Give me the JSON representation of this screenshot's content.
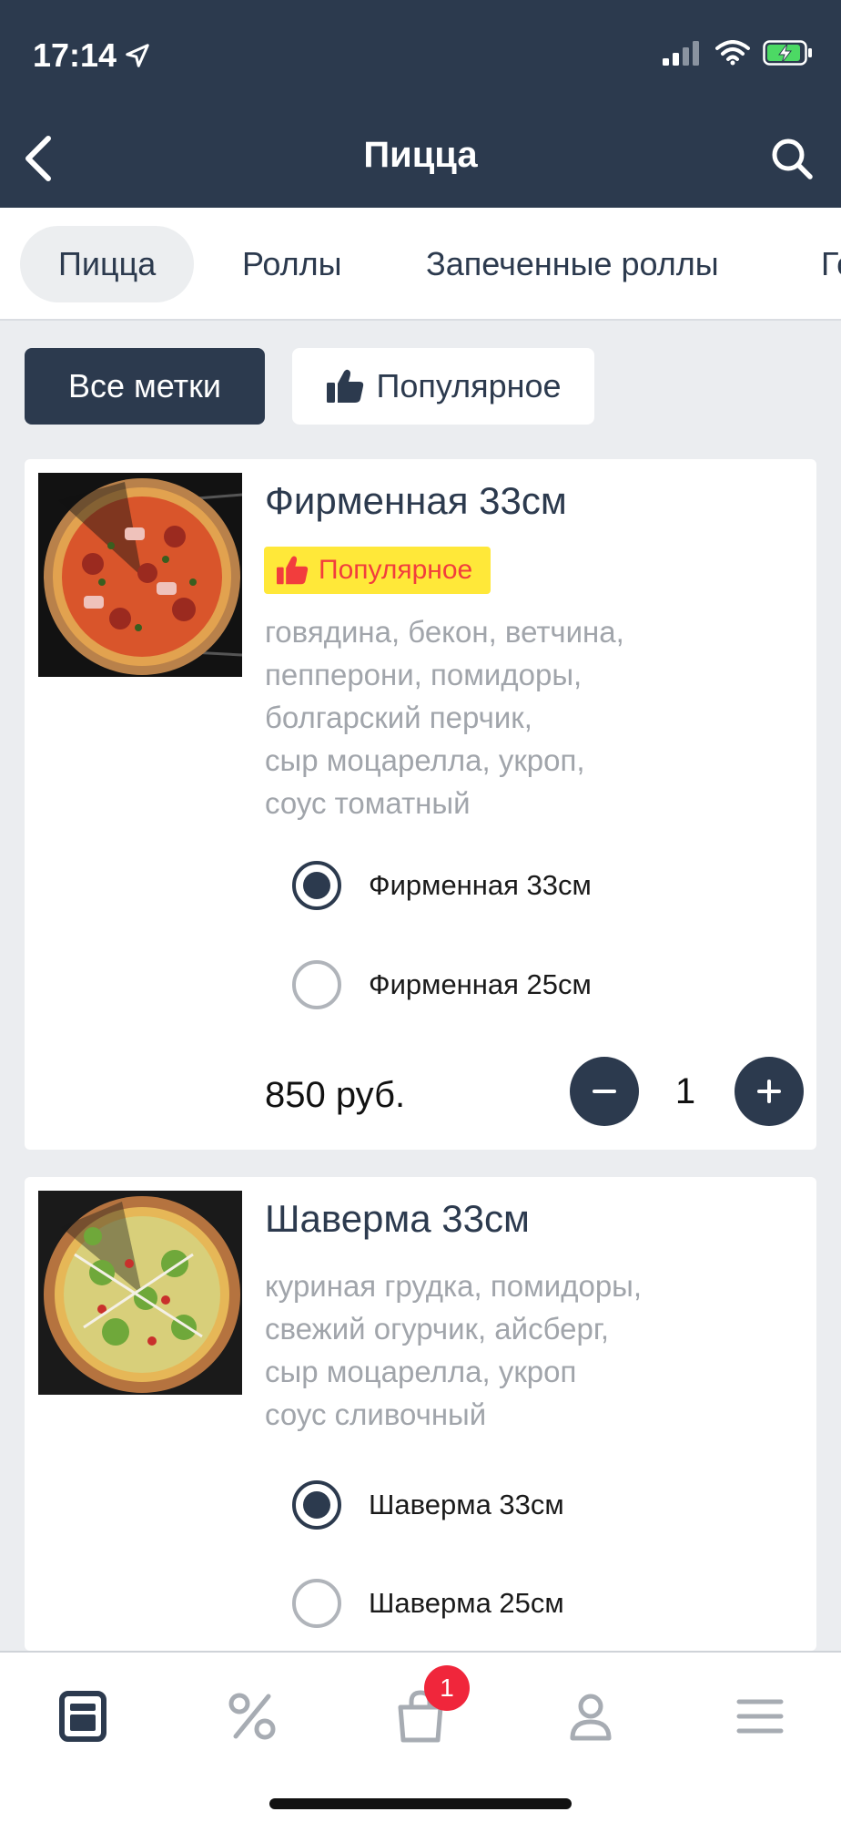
{
  "status_bar": {
    "time": "17:14"
  },
  "header": {
    "title": "Пицца"
  },
  "categories": [
    {
      "label": "Пицца",
      "active": true
    },
    {
      "label": "Роллы"
    },
    {
      "label": "Запеченные роллы"
    },
    {
      "label": "Го"
    }
  ],
  "filters": {
    "all_label": "Все метки",
    "popular_label": "Популярное"
  },
  "products": [
    {
      "title": "Фирменная 33см",
      "badge": "Популярное",
      "description": "говядина, бекон, ветчина,\nпепперони, помидоры,\nболгарский перчик,\nсыр моцарелла, укроп,\nсоус томатный",
      "variants": [
        {
          "label": "Фирменная 33см",
          "selected": true
        },
        {
          "label": "Фирменная 25см",
          "selected": false
        }
      ],
      "price": "850 руб.",
      "quantity": "1"
    },
    {
      "title": "Шаверма 33см",
      "description": "куриная грудка, помидоры,\nсвежий огурчик, айсберг,\nсыр моцарелла, укроп\nсоус сливочный",
      "variants": [
        {
          "label": "Шаверма 33см",
          "selected": true
        },
        {
          "label": "Шаверма 25см",
          "selected": false
        }
      ]
    }
  ],
  "tabbar": {
    "cart_count": "1"
  },
  "colors": {
    "primary": "#2c3a4e",
    "badge_bg": "#ffe839",
    "badge_text": "#f23d3d",
    "cart_badge": "#f0263b"
  }
}
